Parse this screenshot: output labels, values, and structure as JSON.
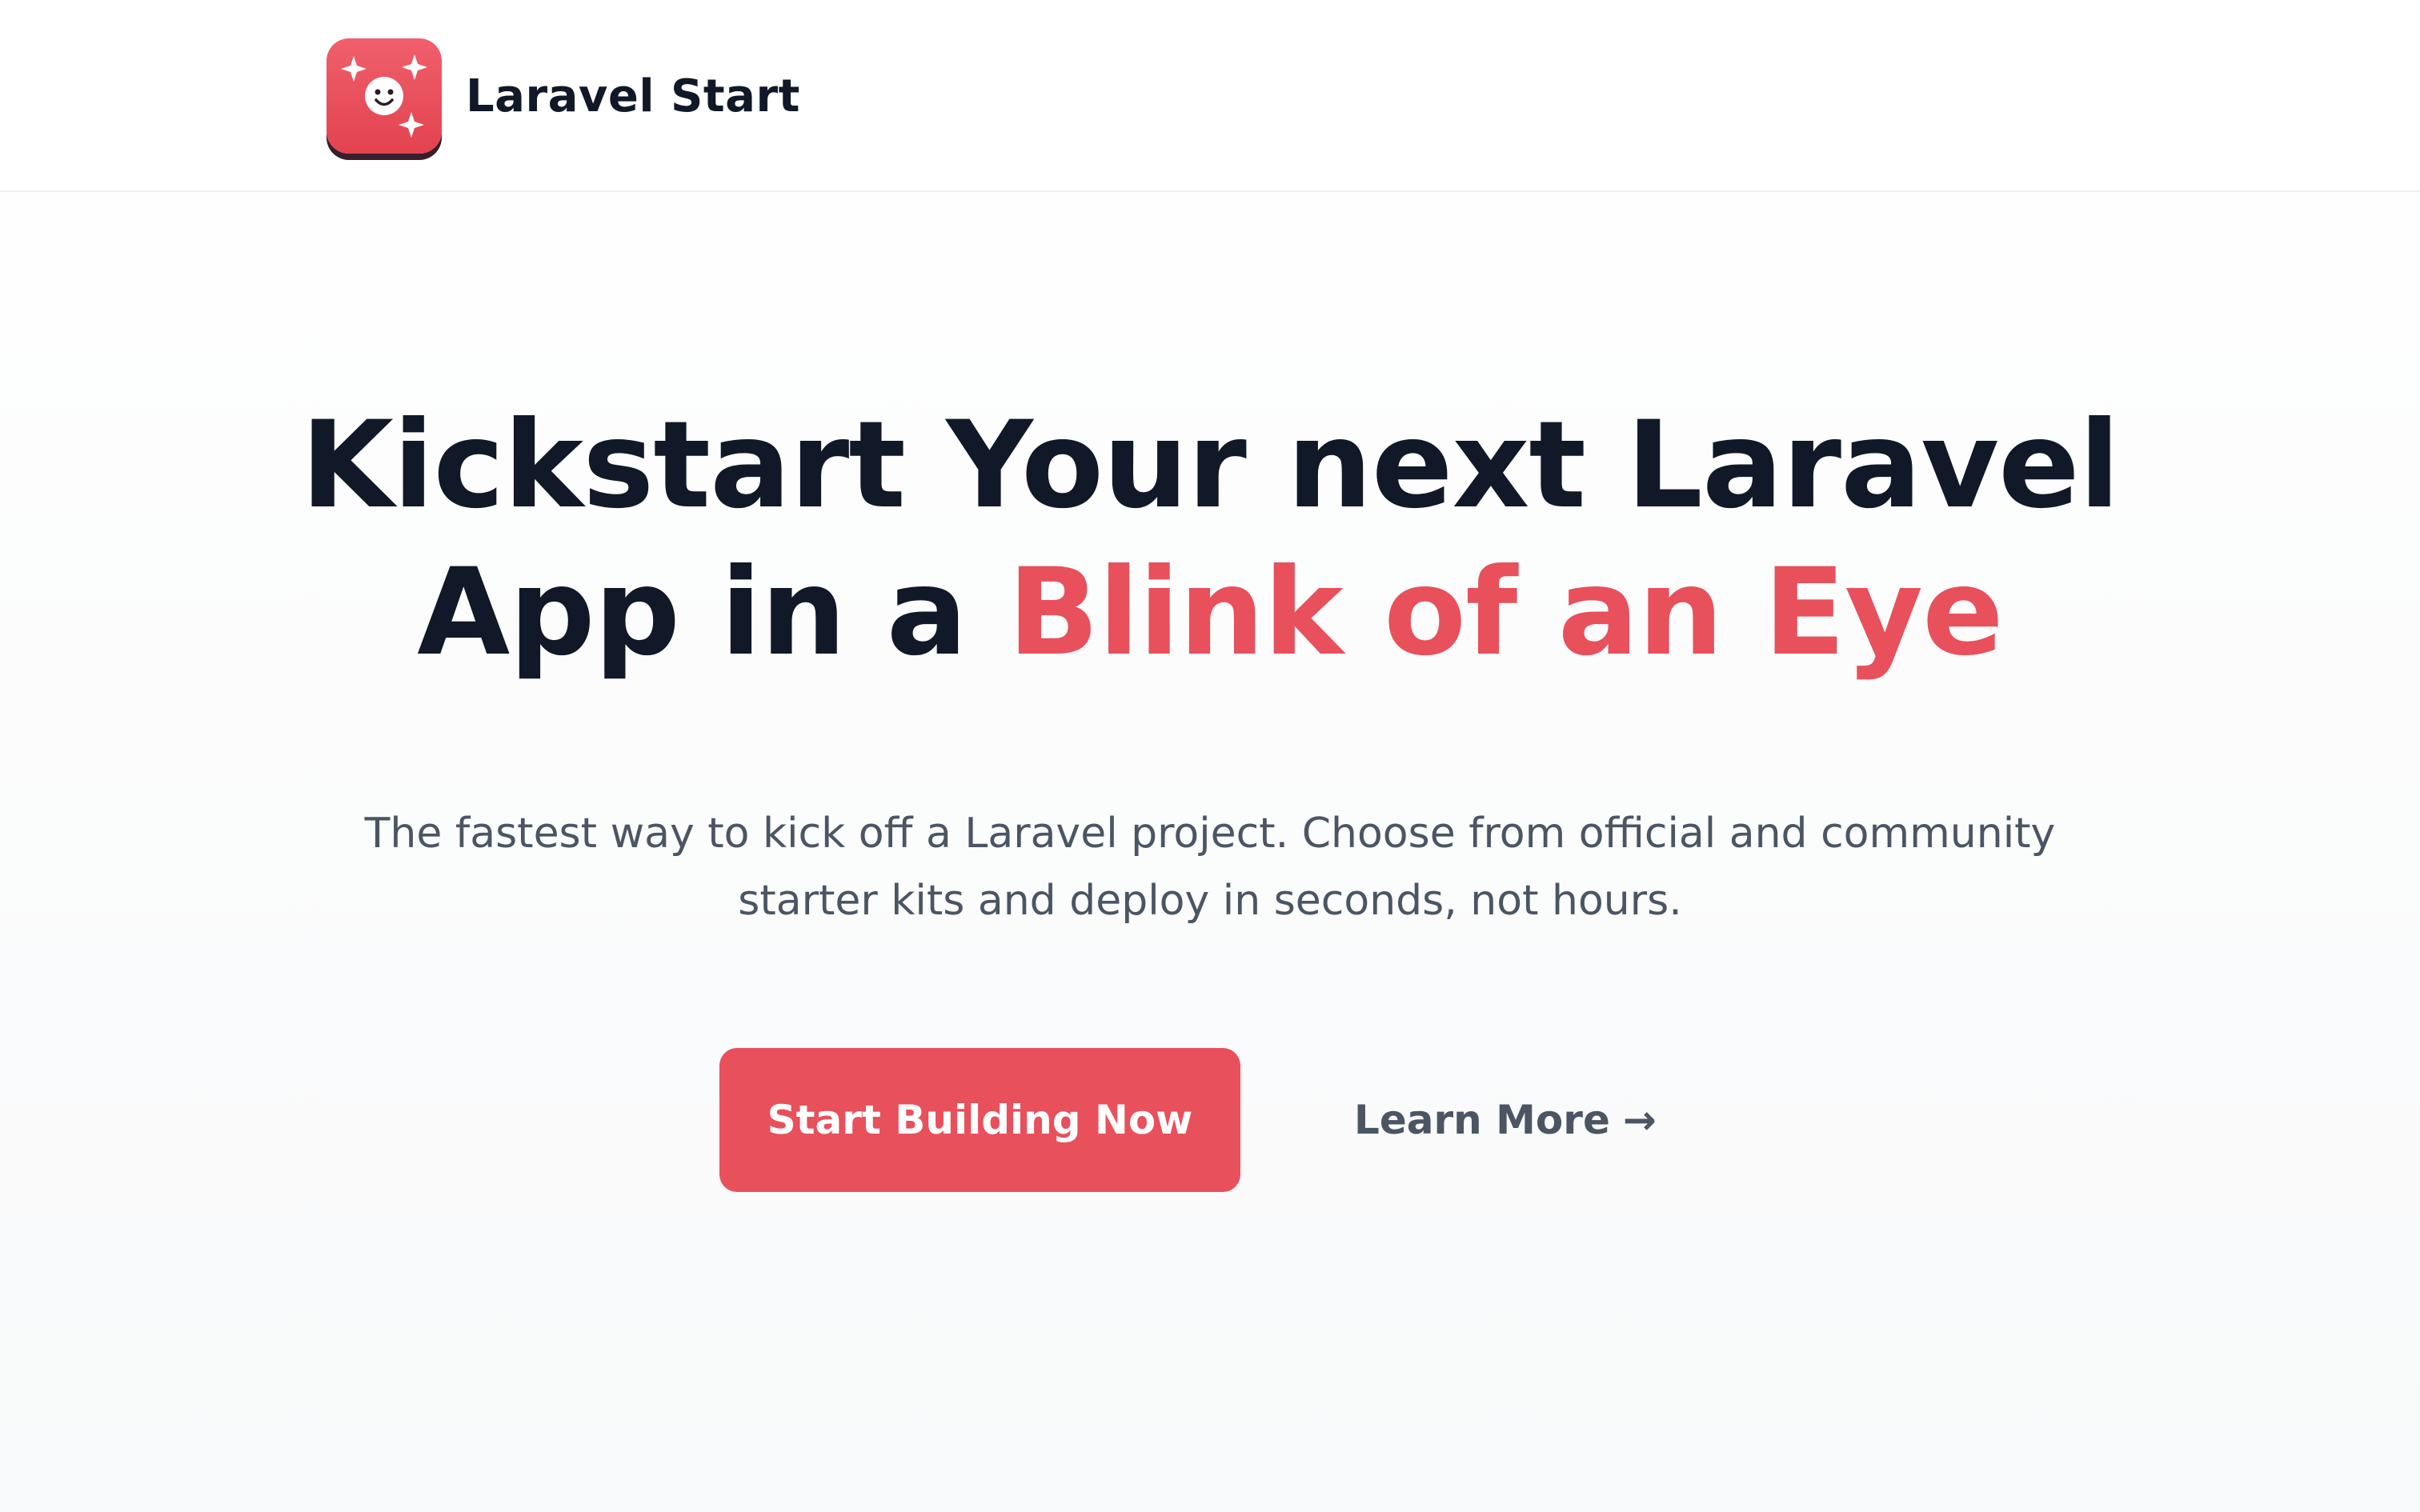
{
  "header": {
    "brand_name": "Laravel Start",
    "logo_icon": "sparkle-face-logo-icon"
  },
  "hero": {
    "headline_part1": "Kickstart Your next Laravel",
    "headline_part2": "App in a ",
    "headline_accent": "Blink of an Eye",
    "subheading_line1": "The fastest way to kick off a Laravel project. Choose from official and community",
    "subheading_line2": "starter kits and deploy in seconds, not hours.",
    "primary_button": "Start Building Now",
    "secondary_link": "Learn More",
    "secondary_icon": "arrow-right-icon"
  },
  "colors": {
    "accent": "#e8505b",
    "heading": "#111827",
    "body_text": "#4b5563",
    "background": "#f8f9fa"
  }
}
